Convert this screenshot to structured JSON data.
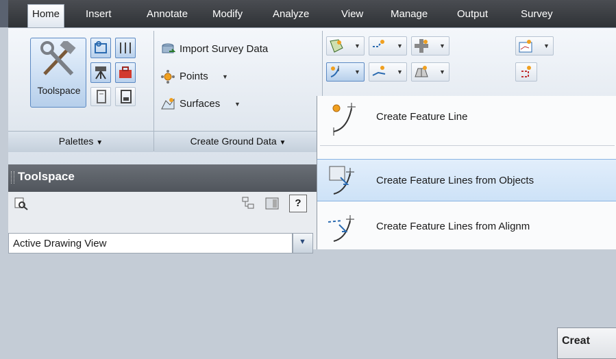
{
  "tabs": [
    "Home",
    "Insert",
    "Annotate",
    "Modify",
    "Analyze",
    "View",
    "Manage",
    "Output",
    "Survey"
  ],
  "palettes": {
    "toolspace_label": "Toolspace",
    "footer": "Palettes"
  },
  "ground_data": {
    "items": [
      {
        "label": "Import Survey Data",
        "icon": "import-survey-icon"
      },
      {
        "label": "Points",
        "icon": "points-icon"
      },
      {
        "label": "Surfaces",
        "icon": "surfaces-icon"
      }
    ],
    "footer": "Create Ground Data"
  },
  "toolspace": {
    "title": "Toolspace",
    "view_select": "Active Drawing View",
    "help_label": "?"
  },
  "menu": {
    "items": [
      {
        "label": "Create Feature Line",
        "icon": "feature-line-icon"
      },
      {
        "label": "Create Feature Lines from Objects",
        "icon": "feature-lines-objects-icon",
        "highlighted": true
      },
      {
        "label": "Create Feature Lines from Alignm",
        "icon": "feature-lines-alignment-icon"
      }
    ],
    "tooltip": "Creat"
  },
  "colors": {
    "accent": "#5a88c2",
    "highlight": "#cde2f7",
    "tabbar": "#2f3236"
  }
}
